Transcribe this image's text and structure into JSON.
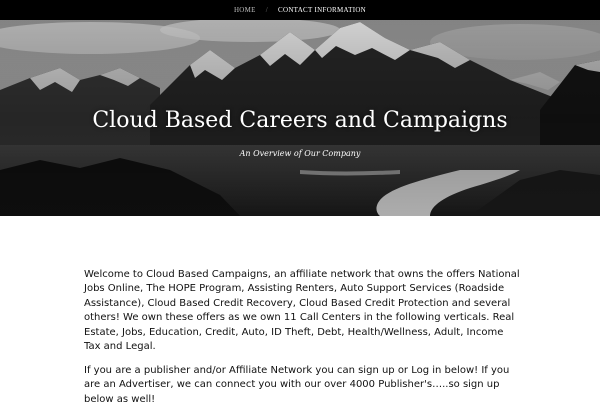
{
  "nav": {
    "items": [
      {
        "label": "HOME"
      },
      {
        "label": "CONTACT INFORMATION"
      }
    ],
    "separator": "/"
  },
  "hero": {
    "title": "Cloud Based Careers and Campaigns",
    "subtitle": "An Overview of Our Company"
  },
  "content": {
    "paragraph_1": "Welcome to Cloud Based Campaigns, an affiliate network that owns the offers National Jobs Online, The HOPE Program, Assisting Renters, Auto Support Services (Roadside Assistance), Cloud Based Credit Recovery, Cloud Based Credit Protection and several others!  We own these offers as we own 11 Call Centers in the following verticals.  Real Estate, Jobs, Education, Credit, Auto, ID Theft, Debt, Health/Wellness, Adult, Income Tax and Legal.",
    "paragraph_2": "If you are a publisher and/or Affiliate Network you can sign up or Log in below!  If you are an Advertiser, we can connect you with our over 4000 Publisher's…..so sign up below as well!"
  },
  "colors": {
    "nav_bg": "#000000",
    "text": "#111111",
    "background": "#ffffff"
  }
}
